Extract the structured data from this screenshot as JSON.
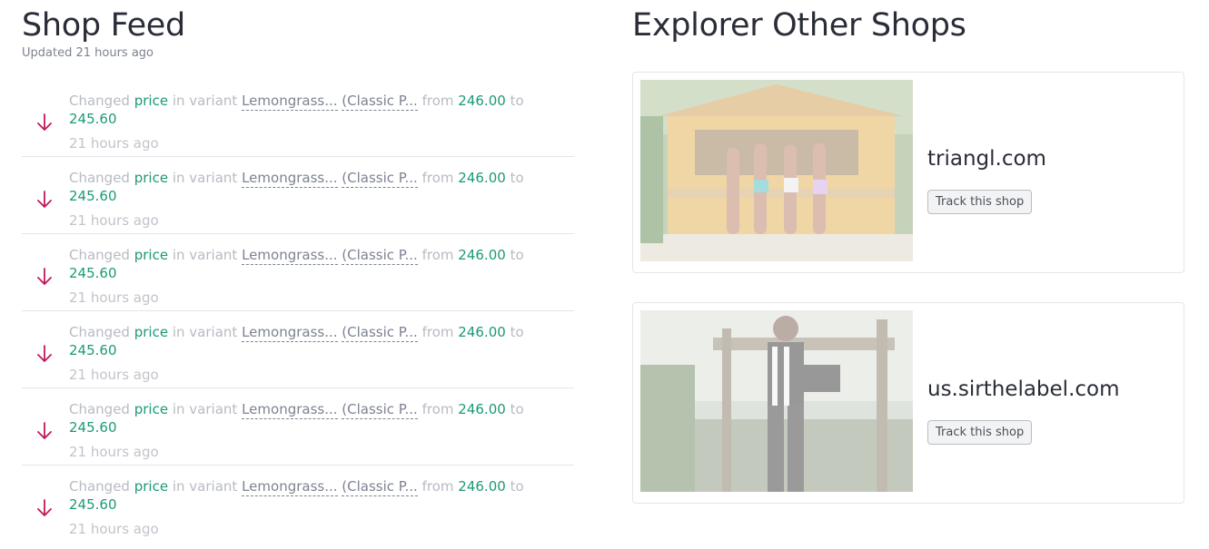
{
  "feed": {
    "title": "Shop Feed",
    "updated": "Updated 21 hours ago",
    "items": [
      {
        "prefix": "Changed",
        "field": "price",
        "mid": "in variant",
        "variant_name": "Lemongrass...",
        "variant_option": "(Classic P...",
        "from_label": "from",
        "old_value": "246.00",
        "to_label": "to",
        "new_value": "245.60",
        "time": "21 hours ago",
        "direction": "down"
      },
      {
        "prefix": "Changed",
        "field": "price",
        "mid": "in variant",
        "variant_name": "Lemongrass...",
        "variant_option": "(Classic P...",
        "from_label": "from",
        "old_value": "246.00",
        "to_label": "to",
        "new_value": "245.60",
        "time": "21 hours ago",
        "direction": "down"
      },
      {
        "prefix": "Changed",
        "field": "price",
        "mid": "in variant",
        "variant_name": "Lemongrass...",
        "variant_option": "(Classic P...",
        "from_label": "from",
        "old_value": "246.00",
        "to_label": "to",
        "new_value": "245.60",
        "time": "21 hours ago",
        "direction": "down"
      },
      {
        "prefix": "Changed",
        "field": "price",
        "mid": "in variant",
        "variant_name": "Lemongrass...",
        "variant_option": "(Classic P...",
        "from_label": "from",
        "old_value": "246.00",
        "to_label": "to",
        "new_value": "245.60",
        "time": "21 hours ago",
        "direction": "down"
      },
      {
        "prefix": "Changed",
        "field": "price",
        "mid": "in variant",
        "variant_name": "Lemongrass...",
        "variant_option": "(Classic P...",
        "from_label": "from",
        "old_value": "246.00",
        "to_label": "to",
        "new_value": "245.60",
        "time": "21 hours ago",
        "direction": "down"
      },
      {
        "prefix": "Changed",
        "field": "price",
        "mid": "in variant",
        "variant_name": "Lemongrass...",
        "variant_option": "(Classic P...",
        "from_label": "from",
        "old_value": "246.00",
        "to_label": "to",
        "new_value": "245.60",
        "time": "21 hours ago",
        "direction": "down"
      }
    ]
  },
  "explore": {
    "title": "Explorer Other Shops",
    "shops": [
      {
        "name": "triangl.com",
        "button_label": "Track this shop",
        "image": "shop-photo-beach-kiosk"
      },
      {
        "name": "us.sirthelabel.com",
        "button_label": "Track this shop",
        "image": "shop-photo-model-tropical"
      }
    ]
  },
  "colors": {
    "accent_green": "#1b9a77",
    "down_arrow": "#c2185b",
    "muted_text": "#b7bbc3"
  }
}
